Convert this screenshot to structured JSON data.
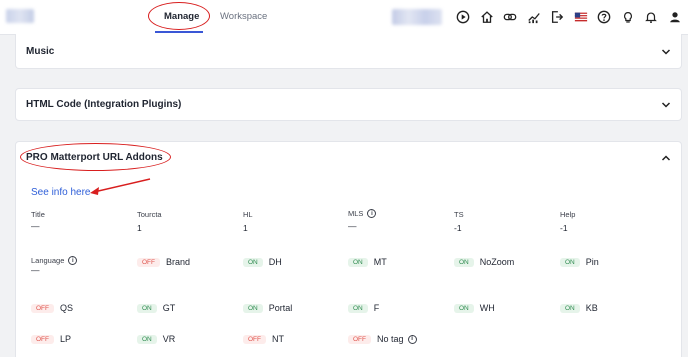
{
  "topbar": {
    "tabs": [
      {
        "label": "Manage",
        "active": true
      },
      {
        "label": "Workspace",
        "active": false
      }
    ],
    "icons": [
      "play-icon",
      "home-icon",
      "link-icon",
      "chart-icon",
      "export-icon",
      "us-flag-icon",
      "help-icon",
      "lightbulb-icon",
      "bell-icon",
      "account-icon"
    ]
  },
  "panels": {
    "music": {
      "title": "Music"
    },
    "html_code": {
      "title": "HTML Code (Integration Plugins)"
    },
    "pro": {
      "title": "PRO Matterport URL Addons",
      "info_link": "See info here"
    }
  },
  "fields": [
    {
      "label": "Title",
      "value": "—"
    },
    {
      "label": "Tourcta",
      "value": "1"
    },
    {
      "label": "HL",
      "value": "1"
    },
    {
      "label": "MLS",
      "value": "—",
      "info": true
    },
    {
      "label": "TS",
      "value": "-1"
    },
    {
      "label": "Help",
      "value": "-1"
    }
  ],
  "language": {
    "label": "Language",
    "value": "—"
  },
  "toggles": [
    {
      "state": "OFF",
      "label": "Brand"
    },
    {
      "state": "ON",
      "label": "DH"
    },
    {
      "state": "ON",
      "label": "MT"
    },
    {
      "state": "ON",
      "label": "NoZoom"
    },
    {
      "state": "ON",
      "label": "Pin"
    },
    {
      "state": "OFF",
      "label": "QS"
    },
    {
      "state": "ON",
      "label": "GT"
    },
    {
      "state": "ON",
      "label": "Portal"
    },
    {
      "state": "ON",
      "label": "F"
    },
    {
      "state": "ON",
      "label": "WH"
    },
    {
      "state": "ON",
      "label": "KB"
    },
    {
      "state": "OFF",
      "label": "LP"
    },
    {
      "state": "ON",
      "label": "VR"
    },
    {
      "state": "OFF",
      "label": "NT"
    },
    {
      "state": "OFF",
      "label": "No tag"
    }
  ],
  "colors": {
    "accent": "#3a57d6",
    "link": "#2f5fd8",
    "annotation": "#d81e1e",
    "on_text": "#2e8b4f",
    "off_text": "#e0544c"
  }
}
